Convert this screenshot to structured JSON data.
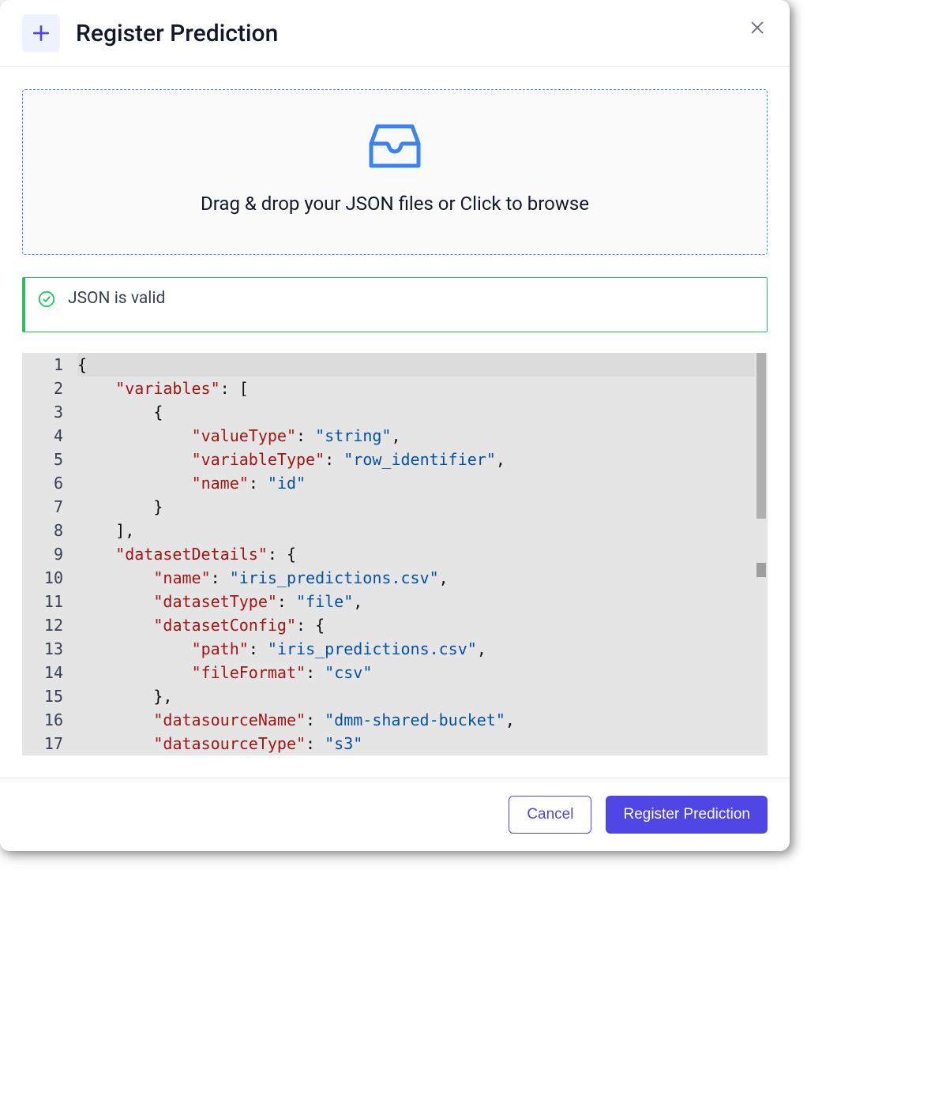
{
  "header": {
    "title": "Register Prediction"
  },
  "dropzone": {
    "text": "Drag & drop your JSON files or Click to browse"
  },
  "status": {
    "message": "JSON is valid"
  },
  "editor": {
    "lines": [
      "{",
      "    \"variables\": [",
      "        {",
      "            \"valueType\": \"string\",",
      "            \"variableType\": \"row_identifier\",",
      "            \"name\": \"id\"",
      "        }",
      "    ],",
      "    \"datasetDetails\": {",
      "        \"name\": \"iris_predictions.csv\",",
      "        \"datasetType\": \"file\",",
      "        \"datasetConfig\": {",
      "            \"path\": \"iris_predictions.csv\",",
      "            \"fileFormat\": \"csv\"",
      "        },",
      "        \"datasourceName\": \"dmm-shared-bucket\",",
      "        \"datasourceType\": \"s3\""
    ],
    "json_value": {
      "variables": [
        {
          "valueType": "string",
          "variableType": "row_identifier",
          "name": "id"
        }
      ],
      "datasetDetails": {
        "name": "iris_predictions.csv",
        "datasetType": "file",
        "datasetConfig": {
          "path": "iris_predictions.csv",
          "fileFormat": "csv"
        },
        "datasourceName": "dmm-shared-bucket",
        "datasourceType": "s3"
      }
    }
  },
  "footer": {
    "cancel_label": "Cancel",
    "submit_label": "Register Prediction"
  }
}
